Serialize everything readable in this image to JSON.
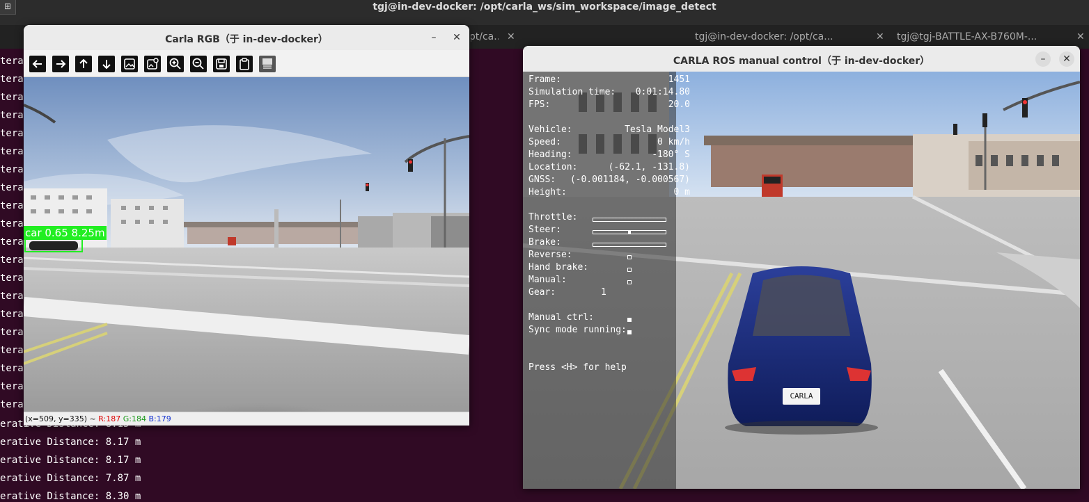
{
  "terminal": {
    "title": "tgj@in-dev-docker: /opt/carla_ws/sim_workspace/image_detect",
    "menu_icon": "⊞",
    "tabs": [
      {
        "label": "tgj@in-dev-docker: /opt/ca..."
      },
      {
        "label": "tgj@in-dev-docker: /opt/ca..."
      },
      {
        "label": "tgj@in-dev-docker: /opt/ca..."
      },
      {
        "label": "tgj@tgj-BATTLE-AX-B760M-..."
      }
    ],
    "tab_close_icon": "✕",
    "left_prefix": "terat",
    "lines": [
      "erative Distance: 8.15 m",
      "erative Distance: 8.17 m",
      "erative Distance: 8.17 m",
      "erative Distance: 7.87 m",
      "erative Distance: 8.30 m"
    ]
  },
  "rgb_window": {
    "title": "Carla RGB（于 in-dev-docker）",
    "minimize": "–",
    "close": "✕",
    "toolbar": [
      {
        "name": "pan-left-icon"
      },
      {
        "name": "pan-right-icon"
      },
      {
        "name": "pan-up-icon"
      },
      {
        "name": "pan-down-icon"
      },
      {
        "name": "thumbnail-icon"
      },
      {
        "name": "image-settings-icon"
      },
      {
        "name": "zoom-in-icon"
      },
      {
        "name": "zoom-out-icon"
      },
      {
        "name": "save-icon"
      },
      {
        "name": "copy-icon"
      },
      {
        "name": "properties-icon"
      }
    ],
    "detection": {
      "label": "car 0.65 8.25m",
      "color": "#22ee22"
    },
    "status": {
      "coords": "(x=509, y=335) ~ ",
      "r": "R:187",
      "g": "G:184",
      "b": "B:179"
    }
  },
  "ros_window": {
    "title": "CARLA ROS manual control（于 in-dev-docker）",
    "minimize": "–",
    "close": "✕",
    "hud": {
      "frame_label": "Frame:",
      "frame": "1451",
      "sim_time_label": "Simulation time:",
      "sim_time": "0:01:14.80",
      "fps_label": "FPS:",
      "fps": "20.0",
      "vehicle_label": "Vehicle:",
      "vehicle": "Tesla Model3",
      "speed_label": "Speed:",
      "speed": "0 km/h",
      "heading_label": "Heading:",
      "heading": "-180° S",
      "location_label": "Location:",
      "location": "(-62.1, -131.8)",
      "gnss_label": "GNSS:",
      "gnss": "(-0.001184, -0.000567)",
      "height_label": "Height:",
      "height": "0 m",
      "throttle_label": "Throttle:",
      "steer_label": "Steer:",
      "brake_label": "Brake:",
      "reverse_label": "Reverse:",
      "hand_brake_label": "Hand brake:",
      "manual_label": "Manual:",
      "gear_label": "Gear:",
      "gear": "1",
      "manual_ctrl_label": "Manual ctrl:",
      "sync_label": "Sync mode running:",
      "help": "Press <H> for help",
      "throttle_value": 0.0,
      "steer_value": 0.0,
      "brake_value": 0.0,
      "reverse": false,
      "hand_brake": false,
      "manual": false,
      "manual_ctrl": true,
      "sync_mode": true
    },
    "license_plate": "CARLA"
  }
}
